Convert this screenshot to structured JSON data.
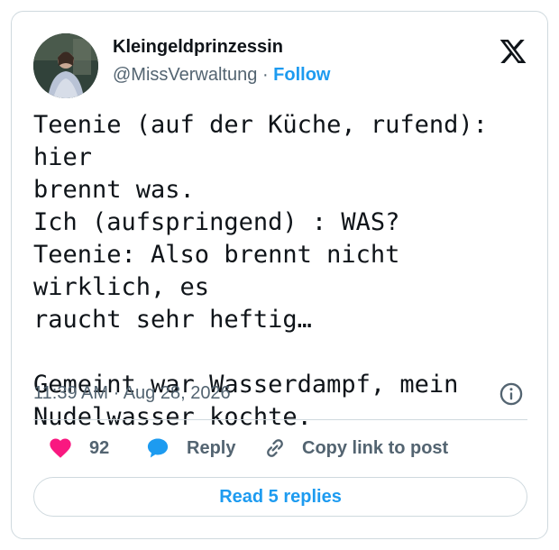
{
  "tweet": {
    "author": {
      "display_name": "Kleingeldprinzessin",
      "handle": "@MissVerwaltung",
      "separator": "·",
      "follow_label": "Follow"
    },
    "text": "Teenie (auf der Küche, rufend): hier\nbrennt was.\nIch (aufspringend) : WAS?\nTeenie: Also brennt nicht wirklich, es\nraucht sehr heftig…\n\nGemeint war Wasserdampf, mein\nNudelwasser kochte.",
    "timestamp": "11:39 AM · Aug 28, 2026",
    "actions": {
      "like_count": "92",
      "reply_label": "Reply",
      "copy_link_label": "Copy link to post"
    },
    "read_replies_label": "Read 5 replies"
  },
  "colors": {
    "like": "#f91880",
    "reply": "#1d9bf0",
    "accent": "#1d9bf0",
    "text": "#0f1419",
    "muted": "#536471",
    "border": "#cfd9de"
  },
  "icons": {
    "platform": "x-logo-icon",
    "info": "info-icon",
    "like": "heart-icon",
    "reply": "speech-bubble-icon",
    "copy": "link-icon"
  }
}
